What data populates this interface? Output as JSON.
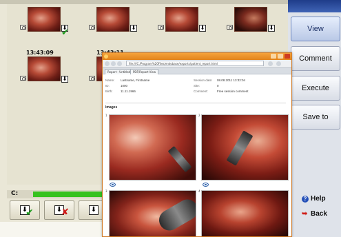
{
  "thumbnails": {
    "time_labels": [
      "13:43:09",
      "13:43:11"
    ]
  },
  "storage": {
    "label": "C:",
    "fill_fraction": 0.62,
    "fill_color": "#37c21f"
  },
  "action_buttons": [
    {
      "name": "download-accept",
      "mark": "✔"
    },
    {
      "name": "download-reject",
      "mark": "✘"
    },
    {
      "name": "download-more",
      "mark": ""
    }
  ],
  "sidebar": {
    "buttons": [
      {
        "label": "View"
      },
      {
        "label": "Comment"
      },
      {
        "label": "Execute"
      },
      {
        "label": "Save to"
      }
    ],
    "help_label": "Help",
    "back_label": "Back"
  },
  "browser": {
    "url": "file:///C:/Program%20Files/endobase/exports/patient_report.html",
    "tabs": [
      "Report - Untitled",
      "PDF/Report View"
    ],
    "info": {
      "name_key": "Name:",
      "name_value": "Lastname, Firstname",
      "id_key": "ID:",
      "id_value": "1000",
      "birth_key": "Birth:",
      "birth_value": "11.11.1966",
      "date_key": "Session date:",
      "date_value": "08.08.2011 13:32:04",
      "site_key": "Site:",
      "site_value": "0",
      "comment_key": "Comment:",
      "comment_value": "Free session comment"
    },
    "images_heading": "Images",
    "image_numbers": [
      "1",
      "2",
      "3",
      "4"
    ]
  },
  "colors": {
    "sidebar_accent": "#2450b8",
    "browser_frame": "#d07a26",
    "check_green": "#1c9a1c",
    "reject_red": "#d01818"
  }
}
